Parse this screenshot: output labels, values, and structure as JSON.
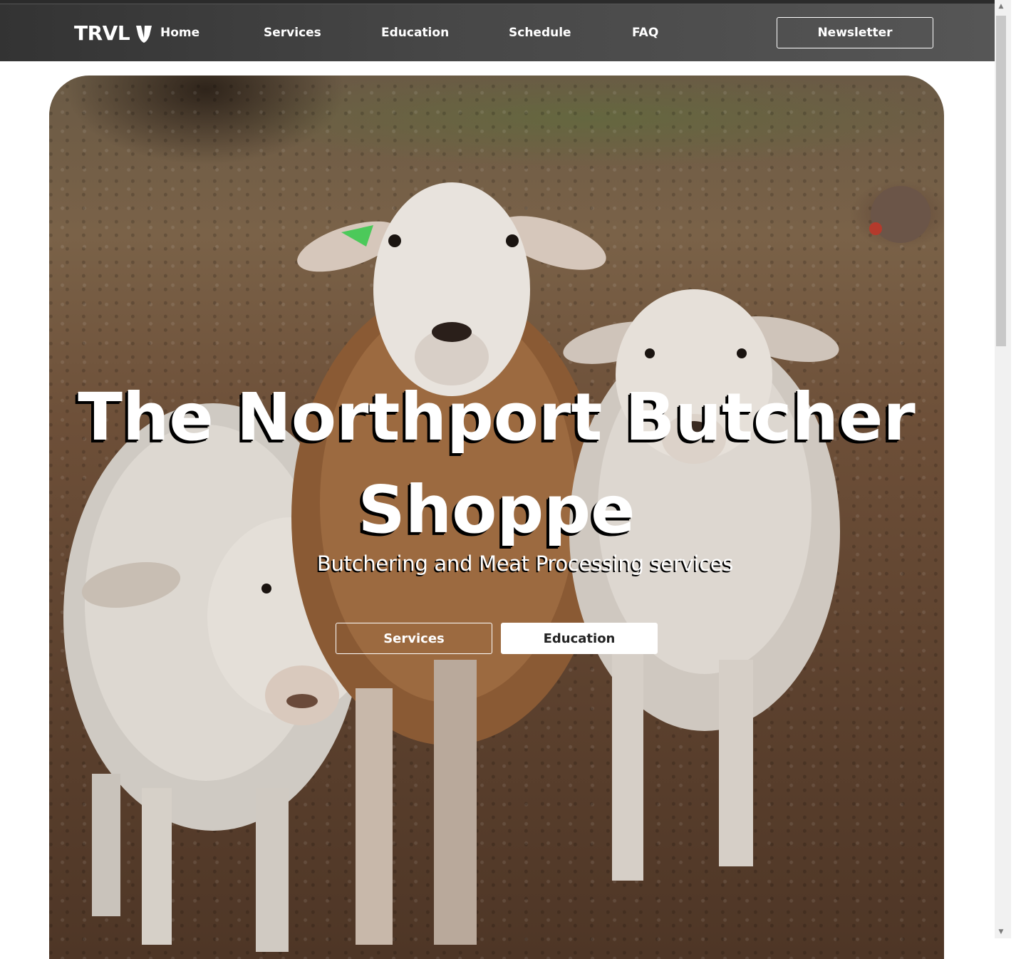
{
  "nav": {
    "brand": "TRVL",
    "items": [
      {
        "label": "Home"
      },
      {
        "label": "Services"
      },
      {
        "label": "Education"
      },
      {
        "label": "Schedule"
      },
      {
        "label": "FAQ"
      }
    ],
    "newsletter_label": "Newsletter"
  },
  "hero": {
    "title_line1": "The Northport Butcher",
    "title_line2": "Shoppe",
    "subtitle": "Butchering and Meat Processing services",
    "buttons": {
      "services_label": "Services",
      "education_label": "Education"
    },
    "image_description_icon": "sheep-photo"
  },
  "scrollbar": {
    "up_icon": "triangle-up-icon",
    "down_icon": "triangle-down-icon"
  }
}
